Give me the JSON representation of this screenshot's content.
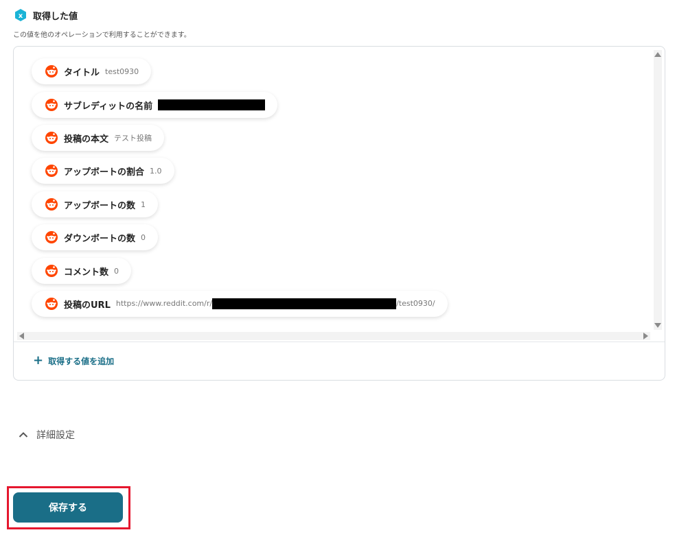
{
  "header": {
    "title": "取得した値",
    "subtitle": "この値を他のオペレーションで利用することができます。"
  },
  "items": [
    {
      "label": "タイトル",
      "value": "test0930",
      "icon": "reddit-icon"
    },
    {
      "label": "サブレディットの名前",
      "value": "",
      "redacted": true,
      "icon": "reddit-icon"
    },
    {
      "label": "投稿の本文",
      "value": "テスト投稿",
      "icon": "reddit-icon"
    },
    {
      "label": "アップボートの割合",
      "value": "1.0",
      "icon": "reddit-icon"
    },
    {
      "label": "アップボートの数",
      "value": "1",
      "icon": "reddit-icon"
    },
    {
      "label": "ダウンボートの数",
      "value": "0",
      "icon": "reddit-icon"
    },
    {
      "label": "コメント数",
      "value": "0",
      "icon": "reddit-icon"
    },
    {
      "label": "投稿のURL",
      "value_prefix": "https://www.reddit.com/r/",
      "value_suffix": "/test0930/",
      "redacted": true,
      "icon": "reddit-icon"
    }
  ],
  "add_value_label": "取得する値を追加",
  "detail_settings_label": "詳細設定",
  "save_button_label": "保存する",
  "colors": {
    "accent": "#1a6e87",
    "reddit": "#ff4500",
    "highlight": "#e5172e",
    "header_icon": "#1ab3d6"
  }
}
